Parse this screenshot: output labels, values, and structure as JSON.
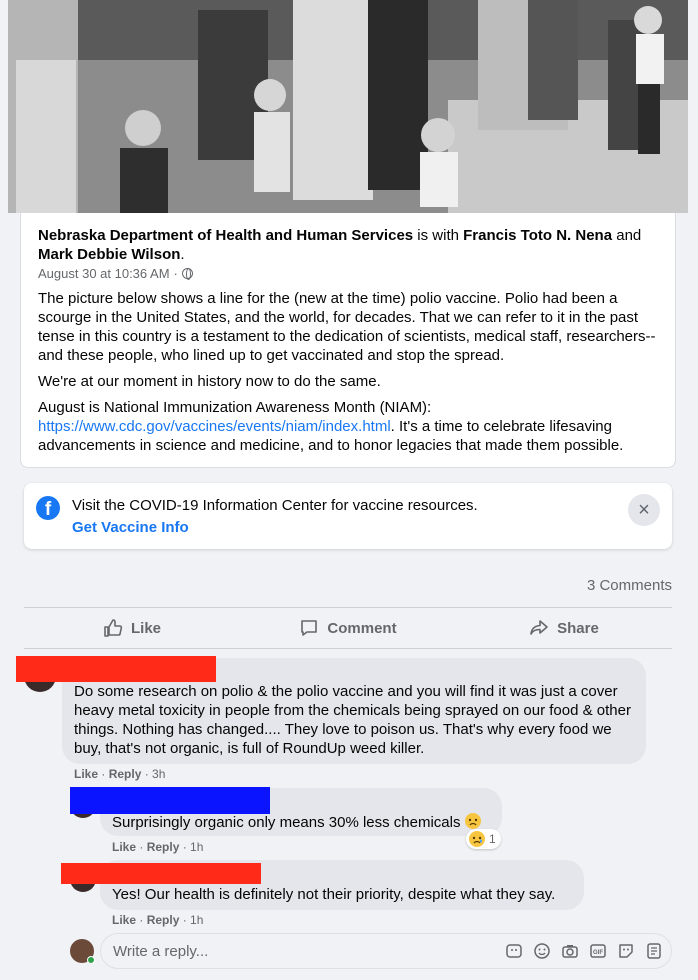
{
  "post": {
    "page_name": "Nebraska Department of Health and Human Services",
    "with_text": " is with ",
    "tagged_1": "Francis Toto N. Nena",
    "and_text": " and ",
    "tagged_2": "Mark Debbie Wilson",
    "period": ".",
    "timestamp": "August 30 at 10:36 AM",
    "separator": "·",
    "privacy_icon": "globe-icon",
    "paragraph_1": "The picture below shows a line for the (new at the time) polio vaccine. Polio had been a scourge in the United States, and the world, for decades. That we can refer to it in the past tense in this country is a testament to the dedication of scientists, medical staff, researchers--and these people, who lined up to get vaccinated and stop the spread.",
    "paragraph_2": "We're at our moment in history now to do the same.",
    "paragraph_3_start": "August is National Immunization Awareness Month (NIAM): ",
    "paragraph_3_link": "https://www.cdc.gov/vaccines/events/niam/index.html",
    "paragraph_3_end": ". It's a time to celebrate lifesaving advancements in science and medicine, and to honor legacies that made them possible."
  },
  "info_center": {
    "text": "Visit the COVID-19 Information Center for vaccine resources.",
    "link": "Get Vaccine Info",
    "icon": "facebook-icon",
    "close": "×"
  },
  "comments_count": "3 Comments",
  "actions": {
    "like": "Like",
    "comment": "Comment",
    "share": "Share"
  },
  "comments": [
    {
      "text": "Do some research on polio & the polio vaccine and you will find it was just a cover heavy metal toxicity in people from the chemicals being sprayed on our food & other things. Nothing has changed.... They love to poison us. That's why every food we buy, that's not organic, is full of RoundUp weed killer.",
      "like": "Like",
      "reply": "Reply",
      "time": "3h"
    },
    {
      "text": "Surprisingly organic only means 30% less chemicals",
      "like": "Like",
      "reply": "Reply",
      "time": "1h",
      "reaction_count": "1"
    },
    {
      "text": "Yes! Our health is definitely not their priority, despite what they say.",
      "like": "Like",
      "reply": "Reply",
      "time": "1h"
    }
  ],
  "reply_box": {
    "placeholder": "Write a reply..."
  },
  "colors": {
    "accent": "#1877f2",
    "redact_red": "#ff2a17",
    "redact_blue": "#0a14ff"
  }
}
